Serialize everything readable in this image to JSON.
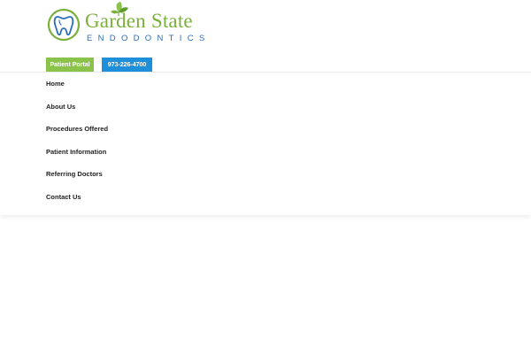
{
  "brand": {
    "name_top": "Garden State",
    "name_bottom": "ENDODONTICS",
    "colors": {
      "green": "#7bb03a",
      "blue": "#2a6eb5"
    },
    "icons": [
      "tooth-icon",
      "leaf-icon"
    ]
  },
  "actions": {
    "portal_label": "Patient Portal",
    "phone_label": "973-226-4700",
    "portal_color": "#8bc34a",
    "phone_color": "#1d8fdb"
  },
  "nav": {
    "items": [
      {
        "label": "Home"
      },
      {
        "label": "About Us"
      },
      {
        "label": "Procedures Offered"
      },
      {
        "label": "Patient Information"
      },
      {
        "label": "Referring Doctors"
      },
      {
        "label": "Contact Us"
      }
    ]
  }
}
